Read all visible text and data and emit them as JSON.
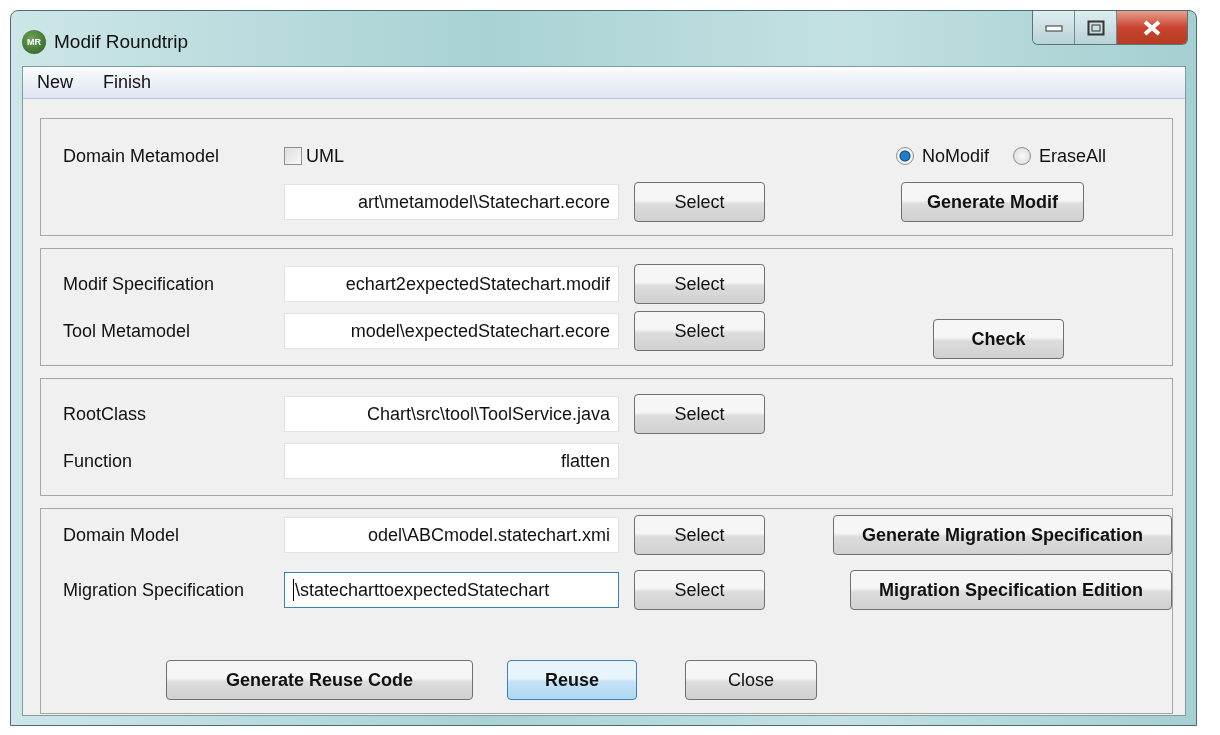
{
  "window": {
    "title": "Modif Roundtrip",
    "logo": "MR"
  },
  "menu": [
    {
      "label": "New"
    },
    {
      "label": "Finish"
    }
  ],
  "domain_metamodel": {
    "label": "Domain Metamodel",
    "uml": {
      "label": "UML",
      "checked": false
    },
    "options": [
      {
        "label": "NoModif",
        "selected": true
      },
      {
        "label": "EraseAll",
        "selected": false
      }
    ],
    "path": {
      "value": "art\\metamodel\\Statechart.ecore",
      "focused": false
    },
    "select": "Select",
    "action": "Generate Modif"
  },
  "specification": {
    "rows": [
      {
        "label": "Modif Specification",
        "path": {
          "value": "echart2expectedStatechart.modif",
          "focused": false
        },
        "select": "Select"
      },
      {
        "label": "Tool Metamodel",
        "path": {
          "value": "model\\expectedStatechart.ecore",
          "focused": false
        },
        "select": "Select"
      }
    ],
    "action": "Check"
  },
  "tool": {
    "rows": [
      {
        "label": "RootClass",
        "path": {
          "value": "Chart\\src\\tool\\ToolService.java",
          "focused": false
        },
        "select": "Select"
      },
      {
        "label": "Function",
        "path": {
          "value": "flatten",
          "focused": false
        }
      }
    ]
  },
  "migration": {
    "rows": [
      {
        "label": "Domain Model",
        "path": {
          "value": "odel\\ABCmodel.statechart.xmi",
          "focused": false
        },
        "select": "Select",
        "action": "Generate Migration Specification"
      },
      {
        "label": "Migration Specification",
        "path": {
          "value": "\\statecharttoexpectedStatechart",
          "focused": true
        },
        "select": "Select",
        "action": "Migration Specification Edition"
      }
    ],
    "buttons": [
      {
        "label": "Generate Reuse Code",
        "default": false
      },
      {
        "label": "Reuse",
        "default": true
      },
      {
        "label": "Close",
        "default": false
      }
    ]
  }
}
